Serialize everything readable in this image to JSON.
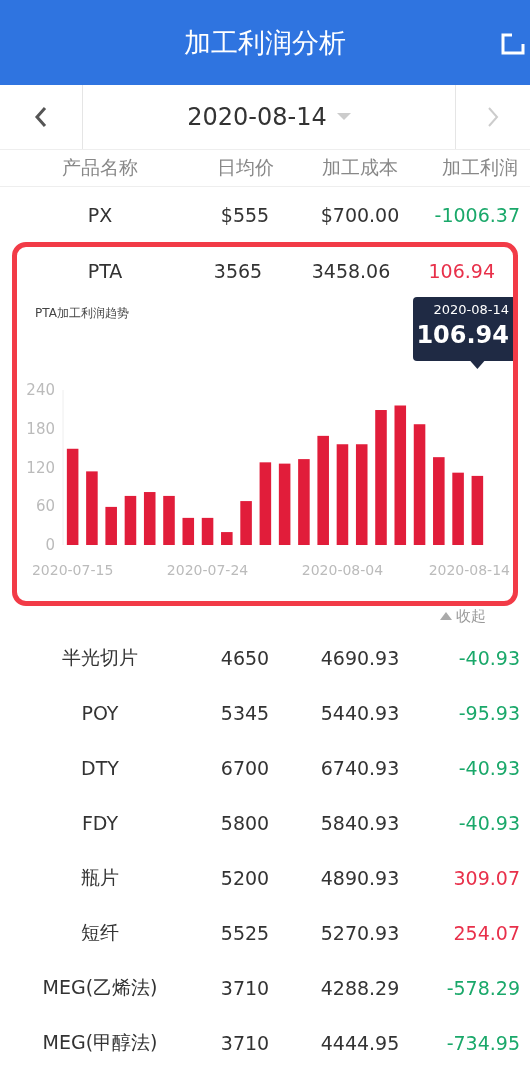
{
  "header": {
    "title": "加工利润分析"
  },
  "date_bar": {
    "date": "2020-08-14"
  },
  "table": {
    "columns": [
      "产品名称",
      "日均价",
      "加工成本",
      "加工利润"
    ],
    "rows_top": [
      {
        "name": "PX",
        "price": "$555",
        "cost": "$700.00",
        "profit": "-1006.37",
        "color": "#1aa86a"
      },
      {
        "name": "PTA",
        "price": "3565",
        "cost": "3458.06",
        "profit": "106.94",
        "color": "#e8304a"
      }
    ],
    "chart": {
      "tooltip": {
        "date": "2020-08-14",
        "value": "106.94"
      },
      "chart_data": {
        "type": "bar",
        "title": "PTA加工利润趋势",
        "categories": [
          "2020-07-15",
          null,
          null,
          null,
          null,
          null,
          null,
          "2020-07-24",
          null,
          null,
          null,
          null,
          null,
          null,
          "2020-08-04",
          null,
          null,
          null,
          null,
          null,
          null,
          "2020-08-14"
        ],
        "series": [
          {
            "color": "#e11d3a",
            "values": [
              149,
              114,
              59,
              76,
              82,
              76,
              42,
              42,
              20,
              68,
              128,
              126,
              133,
              169,
              156,
              156,
              209,
              216,
              187,
              136,
              112,
              107
            ]
          }
        ],
        "ylim": [
          0,
          240
        ],
        "yticks": [
          0,
          60,
          120,
          180,
          240
        ]
      },
      "collapse": "收起"
    },
    "rows": [
      {
        "name": "半光切片",
        "price": "4650",
        "cost": "4690.93",
        "profit": "-40.93",
        "color": "#1aa86a"
      },
      {
        "name": "POY",
        "price": "5345",
        "cost": "5440.93",
        "profit": "-95.93",
        "color": "#1aa86a"
      },
      {
        "name": "DTY",
        "price": "6700",
        "cost": "6740.93",
        "profit": "-40.93",
        "color": "#1aa86a"
      },
      {
        "name": "FDY",
        "price": "5800",
        "cost": "5840.93",
        "profit": "-40.93",
        "color": "#1aa86a"
      },
      {
        "name": "瓶片",
        "price": "5200",
        "cost": "4890.93",
        "profit": "309.07",
        "color": "#e8304a"
      },
      {
        "name": "短纤",
        "price": "5525",
        "cost": "5270.93",
        "profit": "254.07",
        "color": "#e8304a"
      },
      {
        "name": "MEG(乙烯法)",
        "price": "3710",
        "cost": "4288.29",
        "profit": "-578.29",
        "color": "#1aa86a"
      },
      {
        "name": "MEG(甲醇法)",
        "price": "3710",
        "cost": "4444.95",
        "profit": "-734.95",
        "color": "#1aa86a"
      }
    ]
  }
}
